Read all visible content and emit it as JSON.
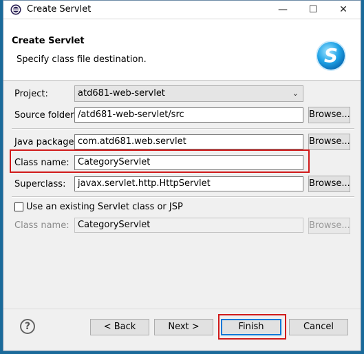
{
  "window": {
    "title": "Create Servlet",
    "controls": {
      "minimize": "—",
      "maximize": "☐",
      "close": "✕"
    }
  },
  "header": {
    "title": "Create Servlet",
    "description": "Specify class file destination.",
    "icon": "servlet-s-logo-icon"
  },
  "form": {
    "project": {
      "label": "Project:",
      "value": "atd681-web-servlet"
    },
    "source_folder": {
      "label": "Source folder:",
      "value": "/atd681-web-servlet/src",
      "browse": "Browse..."
    },
    "java_package": {
      "label": "Java package:",
      "value": "com.atd681.web.servlet",
      "browse": "Browse..."
    },
    "class_name": {
      "label": "Class name:",
      "value": "CategoryServlet"
    },
    "superclass": {
      "label": "Superclass:",
      "value": "javax.servlet.http.HttpServlet",
      "browse": "Browse..."
    },
    "use_existing": {
      "label": "Use an existing Servlet class or JSP",
      "checked": false
    },
    "existing_class_name": {
      "label": "Class name:",
      "value": "CategoryServlet",
      "browse": "Browse..."
    }
  },
  "footer": {
    "help": "?",
    "back": "< Back",
    "next": "Next >",
    "finish": "Finish",
    "cancel": "Cancel"
  },
  "colors": {
    "highlight": "#d11a1a",
    "accent": "#0078d7"
  }
}
